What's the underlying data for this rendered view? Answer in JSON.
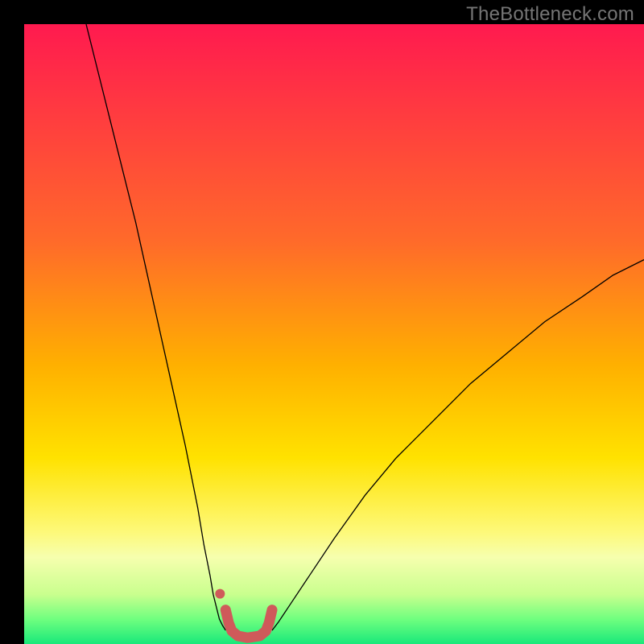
{
  "watermark": "TheBottleneck.com",
  "chart_data": {
    "type": "line",
    "title": "",
    "xlabel": "",
    "ylabel": "",
    "xlim": [
      0,
      100
    ],
    "ylim": [
      0,
      100
    ],
    "grid": false,
    "background_gradient": {
      "stops": [
        {
          "offset": 0.0,
          "color": "#ff1a4f"
        },
        {
          "offset": 0.35,
          "color": "#ff6a2a"
        },
        {
          "offset": 0.55,
          "color": "#ffb000"
        },
        {
          "offset": 0.7,
          "color": "#ffe200"
        },
        {
          "offset": 0.82,
          "color": "#fdf97a"
        },
        {
          "offset": 0.86,
          "color": "#f6ffae"
        },
        {
          "offset": 0.92,
          "color": "#c9ff8e"
        },
        {
          "offset": 0.96,
          "color": "#6fff7f"
        },
        {
          "offset": 1.0,
          "color": "#19e87a"
        }
      ]
    },
    "series": [
      {
        "name": "left-limb",
        "color": "#000000",
        "stroke_width": 1.3,
        "x": [
          10,
          12,
          14,
          16,
          18,
          20,
          22,
          24,
          26,
          28,
          29,
          30,
          30.5,
          31,
          31.5,
          32,
          32.5
        ],
        "values": [
          100,
          92,
          84,
          76,
          68,
          59,
          50,
          41,
          32,
          22,
          16,
          11,
          8,
          6,
          4,
          3,
          2.2
        ]
      },
      {
        "name": "right-limb",
        "color": "#000000",
        "stroke_width": 1.3,
        "x": [
          40,
          41,
          43,
          46,
          50,
          55,
          60,
          66,
          72,
          78,
          84,
          90,
          95,
          100
        ],
        "values": [
          2.2,
          3.5,
          6.5,
          11,
          17,
          24,
          30,
          36,
          42,
          47,
          52,
          56,
          59.5,
          62
        ]
      },
      {
        "name": "trough-marker",
        "color": "#cf5a5a",
        "stroke_width": 13,
        "linecap": "round",
        "x": [
          32.5,
          33,
          33.5,
          34.5,
          36,
          38,
          39,
          39.5,
          40
        ],
        "values": [
          5.5,
          3.4,
          2.1,
          1.3,
          1.0,
          1.3,
          2.1,
          3.4,
          5.5
        ]
      },
      {
        "name": "trough-dot",
        "type": "scatter",
        "color": "#cf5a5a",
        "x": [
          31.6
        ],
        "values": [
          8.1
        ],
        "marker_radius": 6
      }
    ]
  }
}
